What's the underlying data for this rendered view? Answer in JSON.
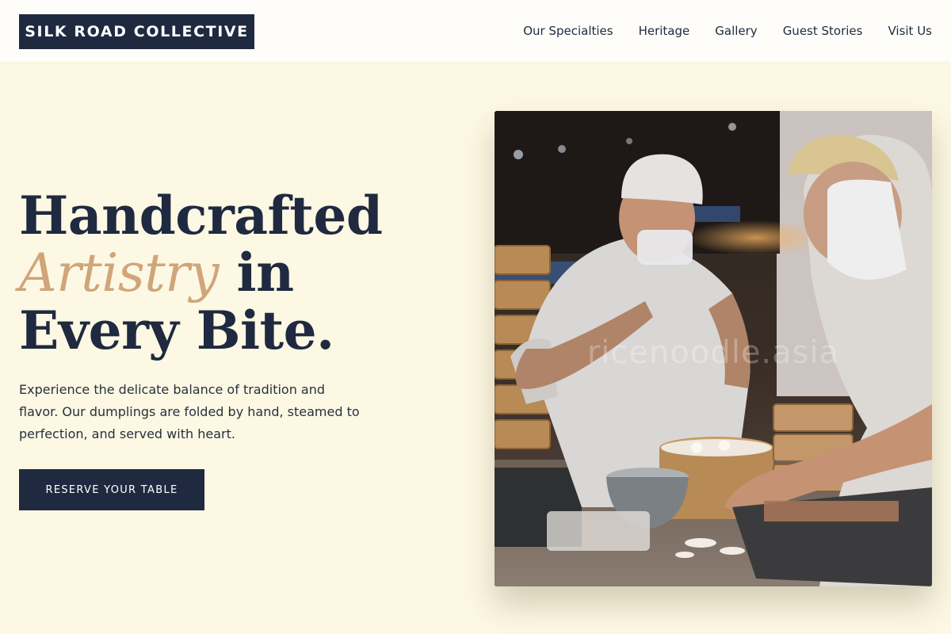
{
  "brand": {
    "name": "SILK ROAD COLLECTIVE"
  },
  "nav": {
    "items": [
      {
        "label": "Our Specialties"
      },
      {
        "label": "Heritage"
      },
      {
        "label": "Gallery"
      },
      {
        "label": "Guest Stories"
      },
      {
        "label": "Visit Us"
      }
    ]
  },
  "hero": {
    "headline_part1": "Handcrafted",
    "headline_accent": "Artistry",
    "headline_part2": " in Every Bite.",
    "subtitle": "Experience the delicate balance of tradition and flavor. Our dumplings are folded by hand, steamed to perfection, and served with heart.",
    "cta_label": "RESERVE YOUR TABLE",
    "image": {
      "watermark": "ricenoodle.asia",
      "depicts": "chefs-folding-dumplings-icon"
    }
  },
  "colors": {
    "navy": "#1f2a40",
    "accent": "#d0a57a",
    "background": "#fdf8e3",
    "header_bg": "#fffdf9"
  }
}
